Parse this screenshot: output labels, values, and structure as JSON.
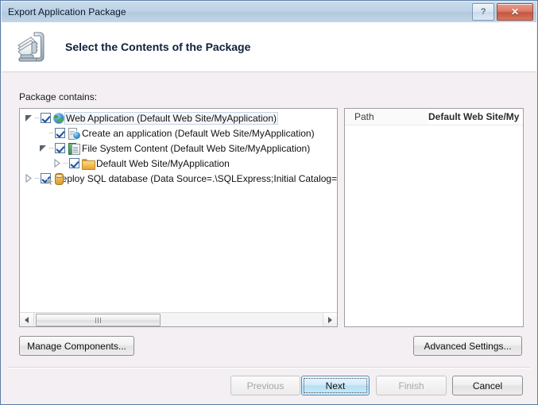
{
  "window": {
    "title": "Export Application Package",
    "help_button": "?",
    "close_button": "✕"
  },
  "header": {
    "title": "Select the Contents of the Package",
    "icon": "package-export-icon"
  },
  "main": {
    "package_label": "Package contains:",
    "tree": [
      {
        "label": "Web Application (Default Web Site/MyApplication)",
        "icon": "globe-icon",
        "depth": 0,
        "expander": "expanded",
        "checked": true,
        "selected": true
      },
      {
        "label": "Create an application (Default Web Site/MyApplication)",
        "icon": "application-document-icon",
        "depth": 1,
        "expander": "none",
        "checked": true,
        "selected": false
      },
      {
        "label": "File System Content (Default Web Site/MyApplication)",
        "icon": "file-system-icon",
        "depth": 1,
        "expander": "expanded",
        "checked": true,
        "selected": false
      },
      {
        "label": "Default Web Site/MyApplication",
        "icon": "folder-icon",
        "depth": 2,
        "expander": "collapsed",
        "checked": true,
        "selected": false
      },
      {
        "label": "Deploy SQL database (Data Source=.\\SQLExpress;Initial Catalog=",
        "icon": "database-icon",
        "depth": 0,
        "expander": "collapsed",
        "checked": true,
        "selected": false
      }
    ],
    "scrollbar": {
      "left_arrow": "◀",
      "right_arrow": "▶"
    },
    "properties": [
      {
        "name": "Path",
        "value": "Default Web Site/My"
      }
    ]
  },
  "buttons": {
    "manage_components": "Manage Components...",
    "advanced_settings": "Advanced Settings...",
    "previous": "Previous",
    "next": "Next",
    "finish": "Finish",
    "cancel": "Cancel"
  },
  "colors": {
    "titlebar": "#bdd2e6",
    "dialog_background": "#f4eff2",
    "default_button_accent": "#b4dff6",
    "close_button": "#c45740"
  }
}
